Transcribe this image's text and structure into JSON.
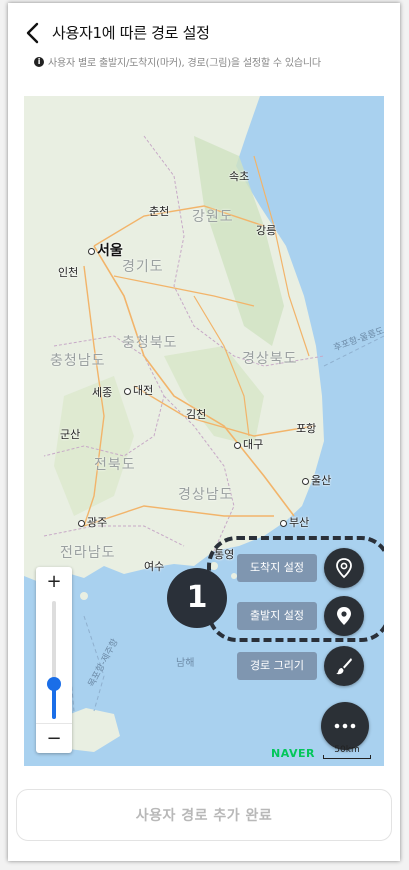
{
  "header": {
    "title": "사용자1에 따른 경로 설정",
    "info_text": "사용자 별로 출발지/도착지(마커), 경로(그림)을 설정할 수 있습니다"
  },
  "map": {
    "labels": {
      "sokcho": "속초",
      "chuncheon": "춘천",
      "gangwon": "강원도",
      "gangneung": "강릉",
      "seoul": "서울",
      "incheon": "인천",
      "gyeonggi": "경기도",
      "chungbuk": "충청북도",
      "chungnam": "충청남도",
      "gyeongbuk": "경상북도",
      "sejong": "세종",
      "daejeon": "대전",
      "gimcheon": "김천",
      "pohang": "포항",
      "gunsan": "군산",
      "daegu": "대구",
      "jeonbuk": "전북도",
      "ulsan": "울산",
      "gyeongnam": "경상남도",
      "gwangju": "광주",
      "busan": "부산",
      "jeonnam": "전라남도",
      "yeosu": "여수",
      "tongyeong": "통영",
      "namhae": "남해",
      "sea_route_east": "후포항-울릉도",
      "sea_route_west": "목포항-제주항"
    },
    "zoom_in": "+",
    "zoom_out": "−",
    "zoom_level": 0.3,
    "brand": "NAVER",
    "scale_label": "50km"
  },
  "controls": {
    "destination_label": "도착지 설정",
    "origin_label": "출발지 설정",
    "draw_route_label": "경로 그리기",
    "annotation_number": "1"
  },
  "footer": {
    "complete_label": "사용자 경로 추가 완료"
  }
}
